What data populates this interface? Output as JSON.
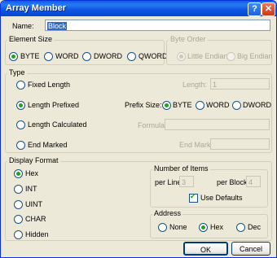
{
  "window": {
    "title": "Array Member",
    "help_glyph": "?",
    "close_glyph": "✕"
  },
  "name": {
    "label": "Name:",
    "value": "Block"
  },
  "element_size": {
    "title": "Element Size",
    "options": [
      "BYTE",
      "WORD",
      "DWORD",
      "QWORD"
    ],
    "selected": "BYTE"
  },
  "byte_order": {
    "title": "Byte Order",
    "options": [
      "Little Endian",
      "Big Endian"
    ],
    "selected": "Little Endian"
  },
  "type": {
    "title": "Type",
    "options": [
      "Fixed Length",
      "Length Prefixed",
      "Length Calculated",
      "End Marked"
    ],
    "selected": "Length Prefixed",
    "length_label": "Length:",
    "length_value": "1",
    "prefix_size_label": "Prefix Size:",
    "prefix_options": [
      "BYTE",
      "WORD",
      "DWORD"
    ],
    "prefix_selected": "BYTE",
    "formula_label": "Formula:",
    "formula_value": "",
    "end_mark_label": "End Mark:",
    "end_mark_value": ""
  },
  "display_format": {
    "title": "Display Format",
    "options": [
      "Hex",
      "INT",
      "UINT",
      "CHAR",
      "Hidden"
    ],
    "selected": "Hex"
  },
  "number_of_items": {
    "title": "Number of Items",
    "per_line_label": "per Line:",
    "per_line_value": "3",
    "per_block_label": "per Block:",
    "per_block_value": "4",
    "use_defaults_label": "Use Defaults",
    "use_defaults_checked": true
  },
  "address": {
    "title": "Address",
    "options": [
      "None",
      "Hex",
      "Dec"
    ],
    "selected": "Hex"
  },
  "buttons": {
    "ok": "OK",
    "cancel": "Cancel"
  }
}
